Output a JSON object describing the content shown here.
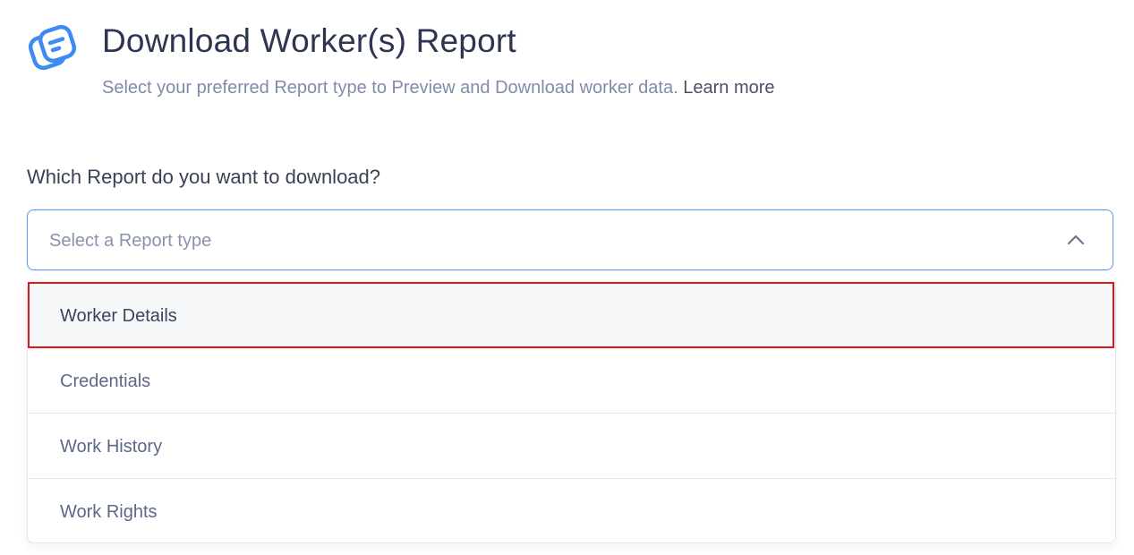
{
  "header": {
    "icon": "report-document-icon",
    "title": "Download Worker(s) Report",
    "subtitle": "Select your preferred Report type to Preview and Download worker data.",
    "learn_more": "Learn more"
  },
  "form": {
    "question": "Which Report do you want to download?",
    "select": {
      "placeholder": "Select a Report type",
      "expanded": true,
      "chevron_icon": "chevron-up-icon",
      "accent_color": "#5f9ceb"
    },
    "options": [
      {
        "label": "Worker Details",
        "highlighted": true
      },
      {
        "label": "Credentials"
      },
      {
        "label": "Work History"
      },
      {
        "label": "Work Rights"
      }
    ]
  },
  "colors": {
    "highlight_outline": "#e0161b",
    "icon_blue": "#3d8bf2"
  }
}
